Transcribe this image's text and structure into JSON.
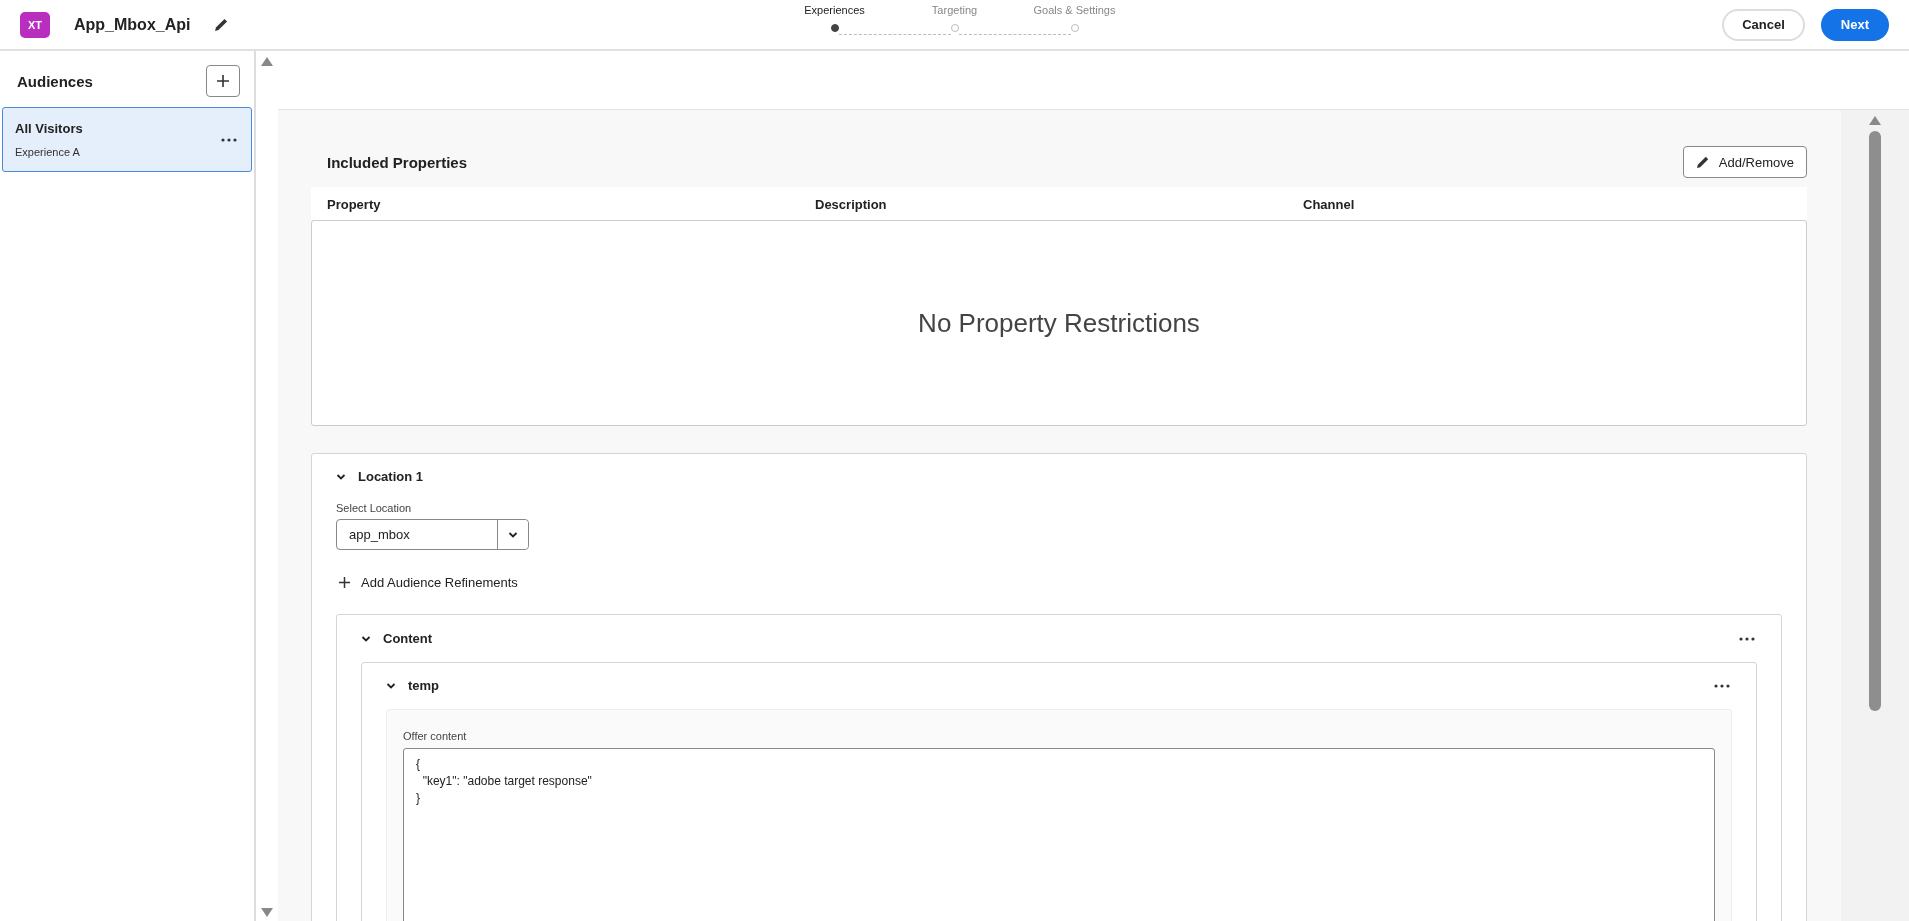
{
  "app": {
    "badge": "XT",
    "title": "App_Mbox_Api"
  },
  "steps": [
    {
      "label": "Experiences",
      "selected": true
    },
    {
      "label": "Targeting",
      "selected": false
    },
    {
      "label": "Goals & Settings",
      "selected": false
    }
  ],
  "actions": [
    {
      "label": "Cancel",
      "kind": "secondary"
    },
    {
      "label": "Next",
      "kind": "primary"
    }
  ],
  "sidebar": {
    "title": "Audiences",
    "items": [
      {
        "name": "All Visitors",
        "experience": "Experience A",
        "selected": true
      }
    ]
  },
  "properties": {
    "title": "Included Properties",
    "action": "Add/Remove",
    "columns": [
      "Property",
      "Description",
      "Channel"
    ],
    "empty": "No Property Restrictions"
  },
  "location": {
    "title": "Location 1",
    "expanded": true,
    "select_label": "Select Location",
    "select_value": "app_mbox",
    "refine": "Add Audience Refinements",
    "content": {
      "title": "Content",
      "expanded": true,
      "offer": {
        "title": "temp",
        "expanded": true,
        "label": "Offer content",
        "value": "{\n  \"key1\": \"adobe target response\"\n}"
      }
    }
  }
}
